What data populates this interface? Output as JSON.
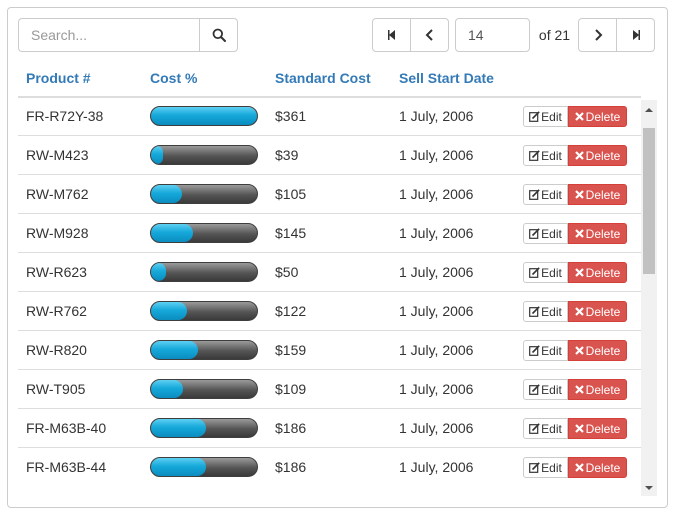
{
  "search": {
    "placeholder": "Search..."
  },
  "pager": {
    "current_page": "14",
    "of_label": "of 21"
  },
  "columns": {
    "product": "Product #",
    "cost_pct": "Cost %",
    "standard_cost": "Standard Cost",
    "sell_start": "Sell Start Date"
  },
  "actions": {
    "edit_label": "Edit",
    "delete_label": "Delete"
  },
  "colors": {
    "header_text": "#337ab7",
    "delete_button": "#d9534f",
    "progress_fill": "#16a9da"
  },
  "rows": [
    {
      "product": "FR-R72Y-38",
      "cost_pct": 100,
      "standard_cost": "$361",
      "sell_start": "1 July, 2006"
    },
    {
      "product": "RW-M423",
      "cost_pct": 11,
      "standard_cost": "$39",
      "sell_start": "1 July, 2006"
    },
    {
      "product": "RW-M762",
      "cost_pct": 29,
      "standard_cost": "$105",
      "sell_start": "1 July, 2006"
    },
    {
      "product": "RW-M928",
      "cost_pct": 40,
      "standard_cost": "$145",
      "sell_start": "1 July, 2006"
    },
    {
      "product": "RW-R623",
      "cost_pct": 14,
      "standard_cost": "$50",
      "sell_start": "1 July, 2006"
    },
    {
      "product": "RW-R762",
      "cost_pct": 34,
      "standard_cost": "$122",
      "sell_start": "1 July, 2006"
    },
    {
      "product": "RW-R820",
      "cost_pct": 44,
      "standard_cost": "$159",
      "sell_start": "1 July, 2006"
    },
    {
      "product": "RW-T905",
      "cost_pct": 30,
      "standard_cost": "$109",
      "sell_start": "1 July, 2006"
    },
    {
      "product": "FR-M63B-40",
      "cost_pct": 52,
      "standard_cost": "$186",
      "sell_start": "1 July, 2006"
    },
    {
      "product": "FR-M63B-44",
      "cost_pct": 52,
      "standard_cost": "$186",
      "sell_start": "1 July, 2006"
    }
  ]
}
